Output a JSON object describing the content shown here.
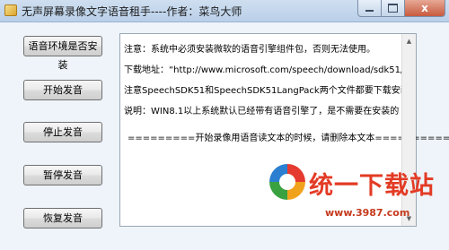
{
  "window": {
    "title": "无声屏幕录像文字语音租手----作者：菜鸟大师",
    "close_label": "x"
  },
  "sidebar": {
    "buttons": [
      {
        "label": "语音环境是否安装"
      },
      {
        "label": "开始发音"
      },
      {
        "label": "停止发音"
      },
      {
        "label": "暂停发音"
      },
      {
        "label": "恢复发音"
      }
    ]
  },
  "textbox": {
    "lines": [
      "注意：系统中必须安装微软的语音引擎组件包，否则无法使用。",
      "下载地址：“http://www.microsoft.com/speech/download/sdk51/”",
      "注意SpeechSDK51和SpeechSDK51LangPack两个文件都要下载安装",
      "说明：WIN8.1以上系统默认已经带有语音引擎了，是不需要在安装的",
      "=========开始录像用语音读文本的时候，请删除本文本============"
    ]
  },
  "watermark": {
    "brand": "统一下载站",
    "url": "www.3987.com"
  }
}
